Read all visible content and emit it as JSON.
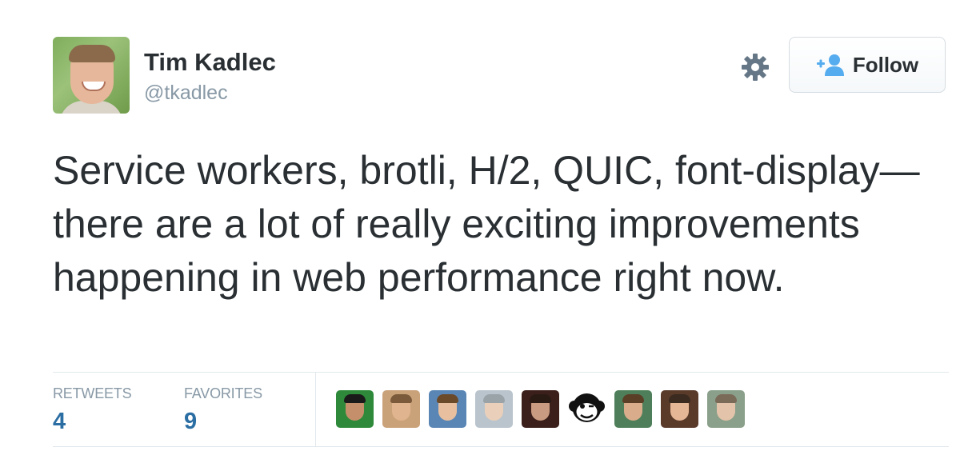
{
  "tweet": {
    "author": {
      "name": "Tim Kadlec",
      "handle": "@tkadlec"
    },
    "follow_label": "Follow",
    "text": "Service workers, brotli, H/2, QUIC, font-display—there are a lot of really exciting improvements happening in web performance right now.",
    "stats": {
      "retweets_label": "RETWEETS",
      "retweets_value": "4",
      "favorites_label": "FAVORITES",
      "favorites_value": "9"
    },
    "favoriters_count": 9
  },
  "colors": {
    "text": "#292f33",
    "muted": "#8899a6",
    "stat_value": "#2b6ea3",
    "follow_icon": "#55acee",
    "divider": "#e1e8ed"
  },
  "icons": {
    "settings": "gear-icon",
    "follow": "follow-person-icon"
  }
}
